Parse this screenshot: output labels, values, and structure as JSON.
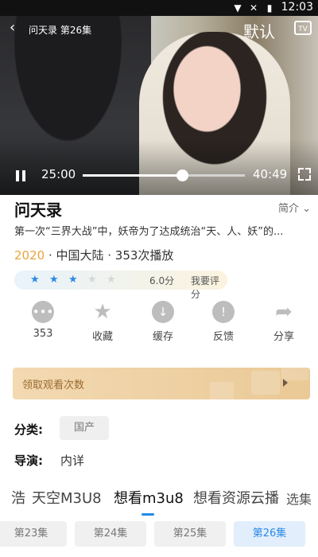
{
  "status_bar": {
    "time": "12:03"
  },
  "player": {
    "title": "问天录 第26集",
    "quality_label": "默认",
    "tv_label": "TV",
    "current_time": "25:00",
    "duration": "40:49",
    "progress": 0.612
  },
  "show": {
    "title": "问天录",
    "intro_label": "简介",
    "synopsis": "第一次“三界大战”中，妖帝为了达成统治“天、人、妖”的...",
    "year": "2020",
    "meta_rest": " · 中国大陆 · 353次播放",
    "rating": {
      "stars_filled": 3,
      "stars_total": 5,
      "score": "6.0分",
      "rate_label": "我要评分"
    }
  },
  "actions": [
    {
      "icon": "comment-icon",
      "label": "353"
    },
    {
      "icon": "star-icon",
      "label": "收藏"
    },
    {
      "icon": "download-icon",
      "label": "缓存"
    },
    {
      "icon": "feedback-icon",
      "label": "反馈"
    },
    {
      "icon": "share-icon",
      "label": "分享"
    }
  ],
  "banner": {
    "text": "领取观看次数"
  },
  "details": {
    "category_label": "分类:",
    "category_value": "国产",
    "director_label": "导演:",
    "director_value": "内详"
  },
  "sources": {
    "tabs": [
      "浩",
      "天空M3U8",
      "想看m3u8",
      "想看资源云播"
    ],
    "active_index": 2,
    "select_label": "选集"
  },
  "episodes": {
    "items": [
      "第23集",
      "第24集",
      "第25集",
      "第26集"
    ],
    "active_index": 3
  },
  "colors": {
    "accent_blue": "#1f8ceb",
    "year_orange": "#e8a53a",
    "star_blue": "#2b8ae6"
  }
}
